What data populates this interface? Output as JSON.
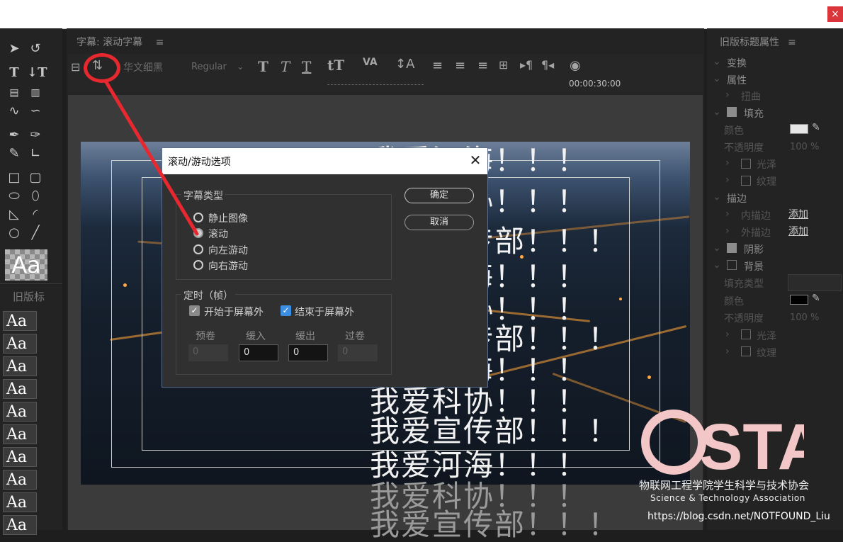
{
  "window": {
    "close_glyph": "×"
  },
  "titler": {
    "tab_title": "字幕: 滚动字幕",
    "menu_glyph": "≡",
    "font_family": "华文细黑",
    "font_style": "Regular",
    "timecode": "00:00:30:00",
    "scroll_text": [
      "我爱河海！！！",
      "我爱科协！！！",
      "我爱宣传部！！！",
      "我爱河海！！！",
      "我爱科协！！！",
      "我爱宣传部！！！",
      "我爱科协！！！",
      "我爱宣传部！！！",
      "我爱河海！！！",
      "我爱科协！！！",
      "我爱宣传部！！！"
    ]
  },
  "tools_panel": {
    "preview_text": "Aa",
    "old_styles_label": "旧版标",
    "style_swatches": [
      "Aa",
      "Aa",
      "Aa",
      "Aa",
      "Aa",
      "Aa",
      "Aa",
      "Aa",
      "Aa",
      "Aa"
    ]
  },
  "properties": {
    "panel_title": "旧版标题属性",
    "transform": "变换",
    "attributes": "属性",
    "distort": "扭曲",
    "fill": "填充",
    "color": "颜色",
    "opacity": "不透明度",
    "opacity_value": "100 %",
    "sheen": "光泽",
    "texture": "纹理",
    "strokes": "描边",
    "inner_stroke": "内描边",
    "outer_stroke": "外描边",
    "add": "添加",
    "shadow": "阴影",
    "background": "背景",
    "fill_type": "填充类型",
    "bg_color": "颜色",
    "bg_opacity": "不透明度",
    "bg_opacity_value": "100 %",
    "bg_sheen": "光泽",
    "bg_texture": "纹理",
    "colors": {
      "fill_swatch": "#e6e6e6",
      "bg_swatch": "#000000"
    }
  },
  "dialog": {
    "title": "滚动/游动选项",
    "close_glyph": "✕",
    "type_group_label": "字幕类型",
    "types": [
      "静止图像",
      "滚动",
      "向左游动",
      "向右游动"
    ],
    "selected_type": "滚动",
    "ok_label": "确定",
    "cancel_label": "取消",
    "timing_group_label": "定时（帧）",
    "start_offscreen": "开始于屏幕外",
    "end_offscreen": "结束于屏幕外",
    "preroll_label": "预卷",
    "easein_label": "缓入",
    "easeout_label": "缓出",
    "postroll_label": "过卷",
    "preroll_value": "0",
    "easein_value": "0",
    "easeout_value": "0",
    "postroll_value": "0",
    "colors": {
      "checkbox_blue": "#3d8ee0"
    }
  },
  "watermark": {
    "cn": "物联网工程学院学生科学与技术协会",
    "en": "Science & Technology Association",
    "url": "https://blog.csdn.net/NOTFOUND_Liu",
    "logo_text": "STA",
    "colors": {
      "logo": "#f3c7c7"
    }
  },
  "annotation": {
    "color": "#e8282f"
  }
}
